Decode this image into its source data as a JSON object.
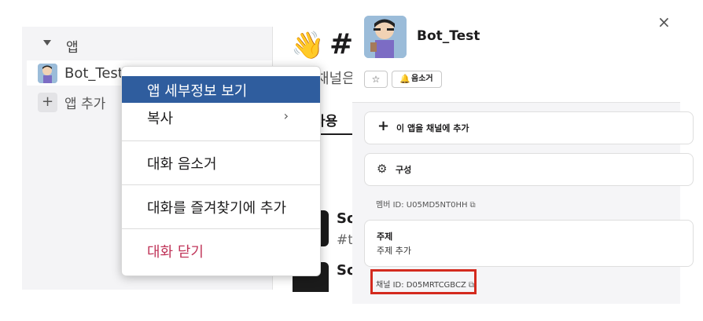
{
  "sidebar": {
    "section_label": "앱",
    "app_name": "Bot_Test",
    "add_app_label": "앱 추가"
  },
  "channel": {
    "emoji": "👋",
    "hash": "#",
    "description": "채널은",
    "tab": "사용",
    "items": [
      {
        "title": "So",
        "subtitle": "#t"
      },
      {
        "title": "So"
      }
    ]
  },
  "context_menu": {
    "items": [
      {
        "label": "앱 세부정보 보기"
      },
      {
        "label": "복사",
        "arrow": "›"
      },
      {
        "label": "대화 음소거"
      },
      {
        "label": "대화를 즐겨찾기에 추가"
      },
      {
        "label": "대화 닫기"
      }
    ]
  },
  "panel": {
    "title": "Bot_Test",
    "close_glyph": "×",
    "star_glyph": "☆",
    "mute_label": "음소거",
    "add_to_channel_label": "이 앱을 채널에 추가",
    "configure_label": "구성",
    "member_id": "멤버 ID: U05MD5NT0HH",
    "topic_heading": "주제",
    "topic_value": "주제 추가",
    "channel_id": "채널 ID: D05MRTCGBCZ"
  },
  "colors": {
    "menu_active_bg": "#2f5d9e",
    "danger": "#c0365a",
    "highlight_box": "#d42a1e"
  }
}
